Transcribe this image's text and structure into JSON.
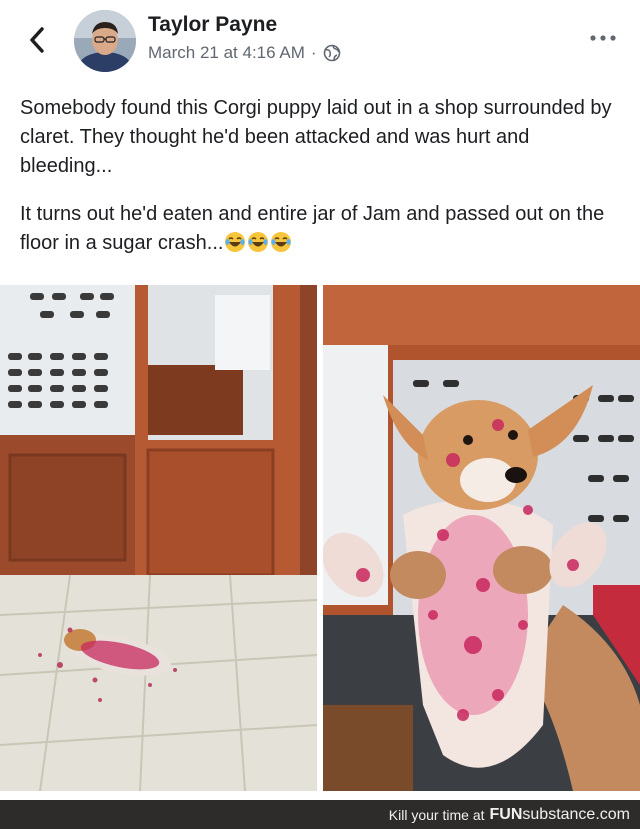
{
  "post": {
    "author": "Taylor Payne",
    "timestamp": "March 21 at 4:16 AM",
    "separator": "·",
    "paragraphs": [
      "Somebody found this Corgi puppy laid out in a shop surrounded by claret. They thought he'd been attacked and was hurt and bleeding...",
      "It turns out he'd eaten and entire jar of Jam and passed out on the floor in a sugar crash..."
    ],
    "emoji": [
      "laughing-tears",
      "laughing-tears",
      "laughing-tears"
    ]
  },
  "icons": {
    "back": "back-arrow-icon",
    "privacy": "globe-icon",
    "more": "more-options-icon"
  },
  "photos": [
    {
      "name": "puppy-on-floor-photo"
    },
    {
      "name": "puppy-held-up-photo"
    }
  ],
  "footer": {
    "caption": "Kill your time at",
    "brand_bold": "FUN",
    "brand_rest": "substance.com"
  },
  "colors": {
    "text": "#1c1e21",
    "meta": "#606770",
    "jam": "#c8285e",
    "footer_bg": "#2d2c2a"
  }
}
